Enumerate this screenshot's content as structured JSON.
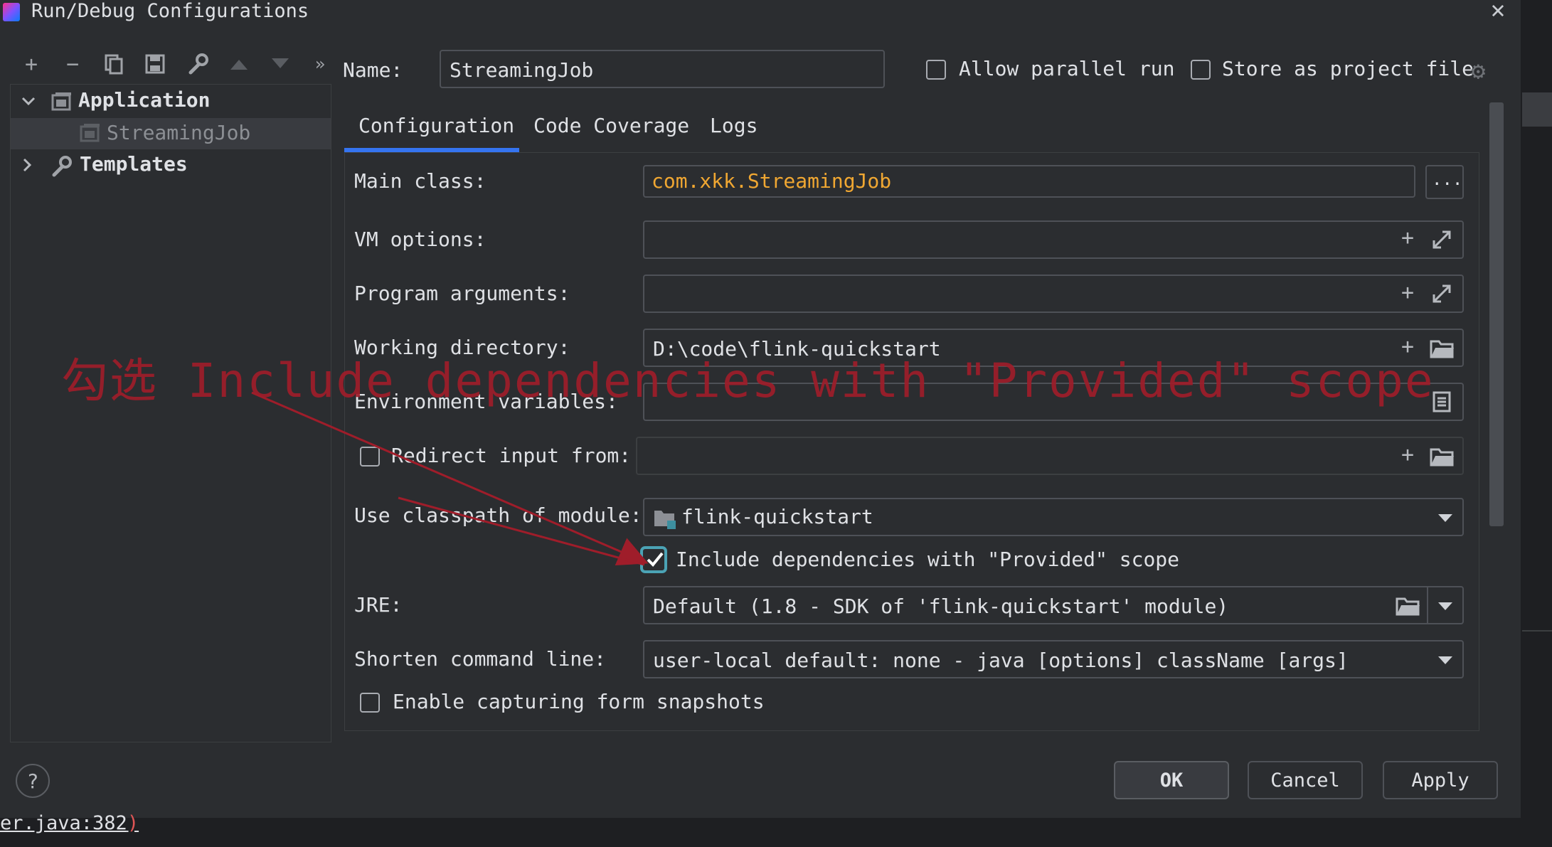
{
  "window": {
    "title": "Run/Debug Configurations"
  },
  "toolbar": {
    "add": "+",
    "remove": "−",
    "more": "»"
  },
  "tree": {
    "application_label": "Application",
    "streaming_job_label": "StreamingJob",
    "templates_label": "Templates"
  },
  "header": {
    "name_label": "Name:",
    "name_value": "StreamingJob",
    "allow_parallel_label": "Allow parallel run",
    "store_project_label": "Store as project file"
  },
  "tabs": [
    "Configuration",
    "Code Coverage",
    "Logs"
  ],
  "form": {
    "main_class_label": "Main class:",
    "main_class_value": "com.xkk.StreamingJob",
    "browse_label": "...",
    "vm_options_label": "VM options:",
    "program_args_label": "Program arguments:",
    "working_dir_label": "Working directory:",
    "working_dir_value": "D:\\code\\flink-quickstart",
    "env_vars_label": "Environment variables:",
    "redirect_label": "Redirect input from:",
    "classpath_label": "Use classpath of module:",
    "classpath_value": "flink-quickstart",
    "include_provided_label": "Include dependencies with \"Provided\" scope",
    "jre_label": "JRE:",
    "jre_value": "Default (1.8 - SDK of 'flink-quickstart' module)",
    "shorten_label": "Shorten command line:",
    "shorten_value": "user-local default: none - java [options] className [args]",
    "snapshots_label": "Enable capturing form snapshots"
  },
  "checkbox_state": {
    "allow_parallel": false,
    "store_project": false,
    "redirect_input": false,
    "include_provided": true,
    "snapshots": false
  },
  "annotation": {
    "text": "勾选 Include dependencies with \"Provided\" scope"
  },
  "buttons": {
    "help": "?",
    "ok": "OK",
    "cancel": "Cancel",
    "apply": "Apply"
  },
  "background_text": {
    "console_link": "er.java:382",
    "console_paren": ")"
  },
  "colors": {
    "accent": "#3574f0",
    "main_class": "#f0a732",
    "annotation": "#9f1d2a",
    "checkbox_focus": "#4ba3b5"
  }
}
